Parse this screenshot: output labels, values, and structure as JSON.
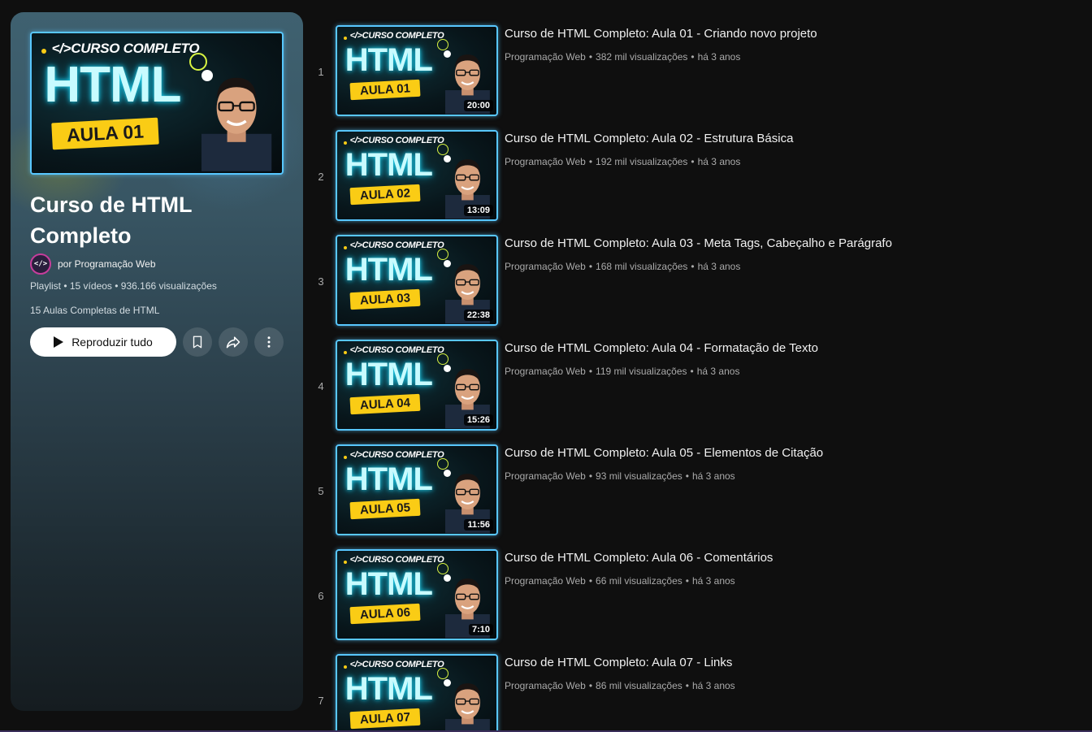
{
  "playlist": {
    "title": "Curso de HTML Completo",
    "owner_avatar_text": "</>",
    "owner_label": "por Programação Web",
    "meta": "Playlist • 15 vídeos • 936.166 visualizações",
    "description": "15 Aulas Completas de HTML",
    "play_all_label": "Reproduzir tudo",
    "thumbnail": {
      "top": "</>CURSO COMPLETO",
      "big": "HTML",
      "tag": "AULA 01"
    },
    "icons": {
      "play": "play-icon",
      "save": "bookmark-icon",
      "share": "share-icon",
      "more": "more-vert-icon"
    }
  },
  "videos": [
    {
      "index": "1",
      "title": "Curso de HTML Completo: Aula 01 - Criando novo projeto",
      "channel": "Programação Web",
      "views": "382 mil visualizações",
      "age": "há 3 anos",
      "duration": "20:00",
      "thumb_top": "</>CURSO COMPLETO",
      "thumb_big": "HTML",
      "thumb_tag": "AULA 01"
    },
    {
      "index": "2",
      "title": "Curso de HTML Completo: Aula 02 - Estrutura Básica",
      "channel": "Programação Web",
      "views": "192 mil visualizações",
      "age": "há 3 anos",
      "duration": "13:09",
      "thumb_top": "</>CURSO COMPLETO",
      "thumb_big": "HTML",
      "thumb_tag": "AULA 02"
    },
    {
      "index": "3",
      "title": "Curso de HTML Completo: Aula 03 - Meta Tags, Cabeçalho e Parágrafo",
      "channel": "Programação Web",
      "views": "168 mil visualizações",
      "age": "há 3 anos",
      "duration": "22:38",
      "thumb_top": "</>CURSO COMPLETO",
      "thumb_big": "HTML",
      "thumb_tag": "AULA 03"
    },
    {
      "index": "4",
      "title": "Curso de HTML Completo: Aula 04 - Formatação de Texto",
      "channel": "Programação Web",
      "views": "119 mil visualizações",
      "age": "há 3 anos",
      "duration": "15:26",
      "thumb_top": "</>CURSO COMPLETO",
      "thumb_big": "HTML",
      "thumb_tag": "AULA 04"
    },
    {
      "index": "5",
      "title": "Curso de HTML Completo: Aula 05 - Elementos de Citação",
      "channel": "Programação Web",
      "views": "93 mil visualizações",
      "age": "há 3 anos",
      "duration": "11:56",
      "thumb_top": "</>CURSO COMPLETO",
      "thumb_big": "HTML",
      "thumb_tag": "AULA 05"
    },
    {
      "index": "6",
      "title": "Curso de HTML Completo: Aula 06 - Comentários",
      "channel": "Programação Web",
      "views": "66 mil visualizações",
      "age": "há 3 anos",
      "duration": "7:10",
      "thumb_top": "</>CURSO COMPLETO",
      "thumb_big": "HTML",
      "thumb_tag": "AULA 06"
    },
    {
      "index": "7",
      "title": "Curso de HTML Completo: Aula 07 - Links",
      "channel": "Programação Web",
      "views": "86 mil visualizações",
      "age": "há 3 anos",
      "duration": "",
      "thumb_top": "</>CURSO COMPLETO",
      "thumb_big": "HTML",
      "thumb_tag": "AULA 07"
    }
  ],
  "meta_separator": "•",
  "colors": {
    "background": "#0f0f0f",
    "thumb_border": "#58c7ff",
    "aula_tag": "#facc15",
    "owner_ring": "#c63d9b"
  }
}
